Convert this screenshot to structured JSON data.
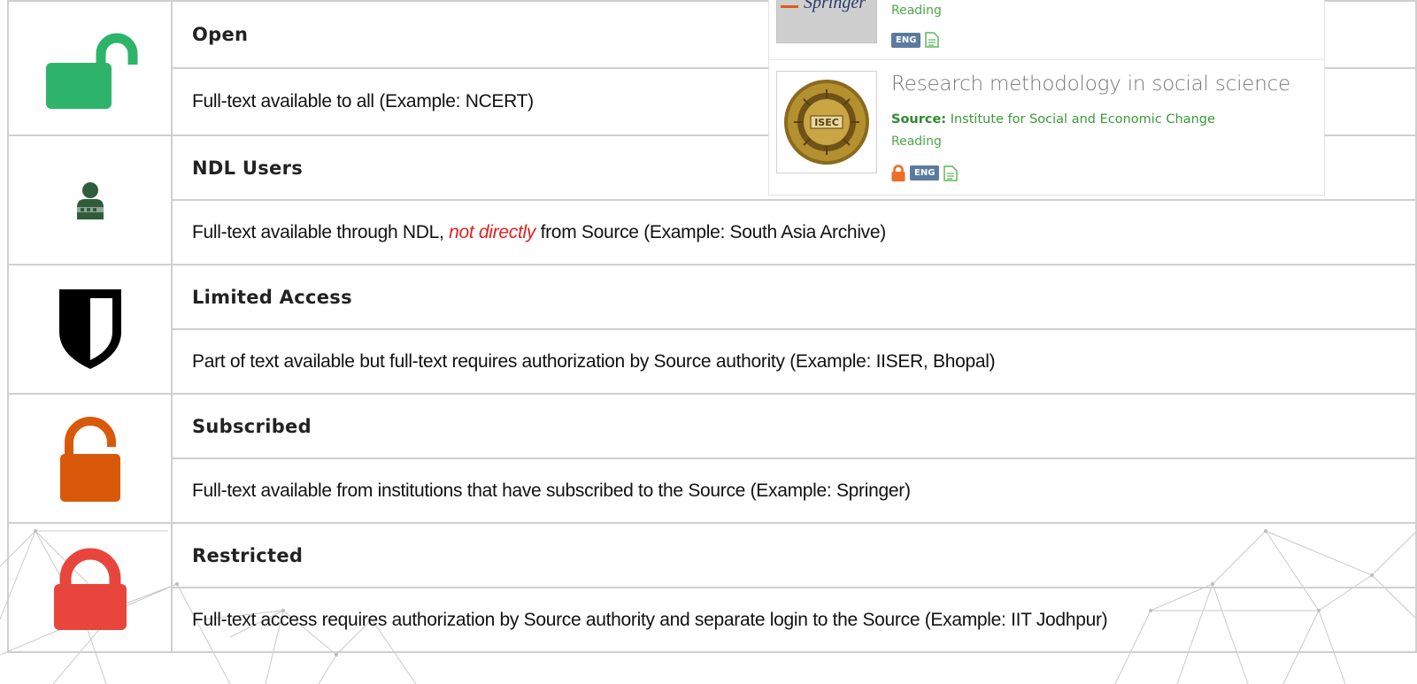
{
  "legend": {
    "rows": [
      {
        "icon": "open-lock-icon",
        "title": "Open",
        "description": "Full-text available to all (Example: NCERT)"
      },
      {
        "icon": "ndl-user-icon",
        "title": "NDL Users",
        "description_prefix": "Full-text available through NDL, ",
        "description_highlight": "not directly",
        "description_suffix": " from Source (Example: South Asia Archive)"
      },
      {
        "icon": "shield-icon",
        "title": "Limited Access",
        "description": "Part of text available but full-text requires authorization by Source authority (Example: IISER, Bhopal)"
      },
      {
        "icon": "subscribed-lock-icon",
        "title": "Subscribed",
        "description": "Full-text available from institutions that have subscribed to the Source (Example: Springer)"
      },
      {
        "icon": "restricted-lock-icon",
        "title": "Restricted",
        "description": "Full-text access requires authorization by Source authority and separate login to the Source (Example: IIT Jodhpur)"
      }
    ]
  },
  "colors": {
    "open": "#2eb46a",
    "ndl_user": "#2f5d3a",
    "limited": "#000000",
    "subscribed": "#d9590b",
    "restricted": "#e8453c",
    "highlight": "#e02020"
  },
  "popup": {
    "result1": {
      "type": "Reading",
      "language": "ENG",
      "thumbnail_text": "Springer"
    },
    "result2": {
      "title": "Research methodology in social science",
      "source_label": "Source:",
      "source": "Institute for Social and Economic Change",
      "type": "Reading",
      "language": "ENG",
      "logo_text": "ISEC"
    }
  }
}
